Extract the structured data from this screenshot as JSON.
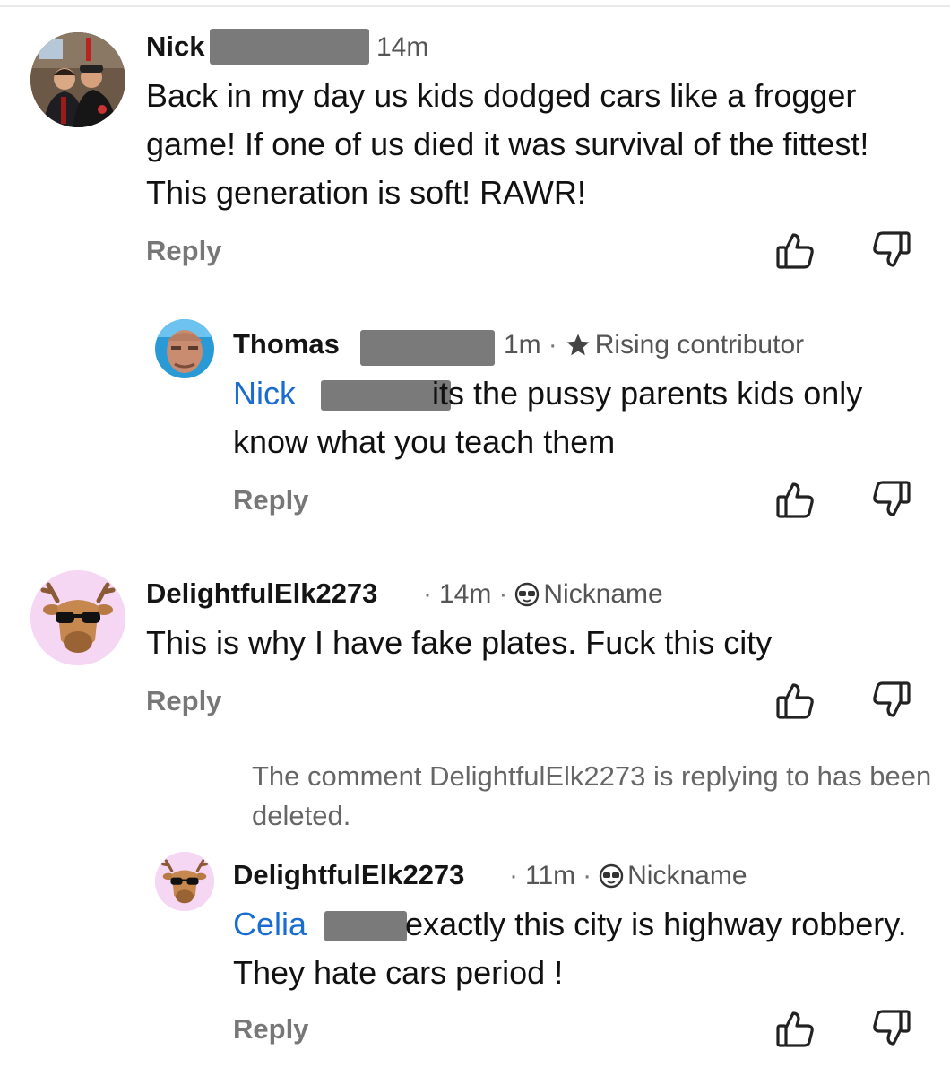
{
  "comments": [
    {
      "name": "Nick",
      "time": "14m",
      "text": "Back in my day us kids dodged cars like a frogger game! If one of us died it was survival of the fittest! This generation is soft! RAWR!",
      "reply_label": "Reply"
    },
    {
      "name": "Thomas",
      "time": "1m",
      "badge": "Rising contributor",
      "mention": "Nick",
      "text": "its the pussy parents kids only know what you teach them",
      "reply_label": "Reply"
    },
    {
      "name": "DelightfulElk2273",
      "time": "14m",
      "badge": "Nickname",
      "text": "This is why I have fake plates.  Fuck this city",
      "reply_label": "Reply"
    },
    {
      "deleted_notice": "The comment DelightfulElk2273 is replying to has been deleted."
    },
    {
      "name": "DelightfulElk2273",
      "time": "11m",
      "badge": "Nickname",
      "mention": "Celia",
      "text": "exactly this city is highway robbery.  They hate cars period !",
      "reply_label": "Reply"
    }
  ],
  "separator": "·",
  "colors": {
    "mention": "#1a6dd0",
    "redaction": "#7a7a7a",
    "elk_bg": "#f5d7f3"
  },
  "icons": [
    "thumbs-up-icon",
    "thumbs-down-icon",
    "star-icon",
    "sunglasses-icon"
  ]
}
